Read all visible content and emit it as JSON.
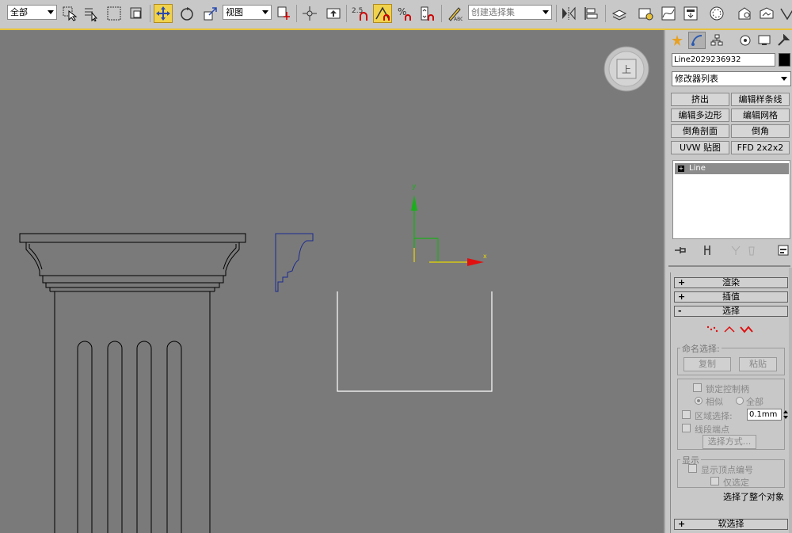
{
  "toolbar": {
    "selection_filter": "全部",
    "ref_coord_system": "视图",
    "snap_value": "2.5",
    "named_selection_placeholder": "创建选择集",
    "icons": [
      "select-object-icon",
      "select-by-name-icon",
      "rect-selection-icon",
      "window-crossing-icon",
      "select-and-move-icon",
      "select-and-rotate-icon",
      "select-and-scale-icon",
      "use-pivot-icon",
      "manipulate-icon",
      "keyboard-shortcut-icon",
      "snaps-toggle-icon",
      "angle-snap-icon",
      "percent-snap-icon",
      "spinner-snap-icon",
      "edit-named-selection-icon",
      "mirror-icon",
      "align-icon",
      "layer-manager-icon",
      "graphite-tools-icon",
      "curve-editor-icon",
      "schematic-view-icon",
      "material-editor-icon",
      "render-setup-icon",
      "rendered-frame-icon",
      "render-icon"
    ]
  },
  "viewport": {
    "viewcube_label": "上",
    "gizmo_y_label": "y",
    "gizmo_x_label": "x",
    "colors": {
      "gizmo_y": "#1cae1c",
      "gizmo_x": "#e01010",
      "gizmo_plane": "#e8d800",
      "profile_shape": "#1a2a90",
      "lines": "#000000",
      "rectangle": "#ffffff"
    }
  },
  "command_panel": {
    "tabs": [
      "create-tab-icon",
      "modify-tab-icon",
      "hierarchy-tab-icon",
      "motion-tab-icon",
      "display-tab-icon",
      "utilities-tab-icon"
    ],
    "object_name": "Line2029236932",
    "modifier_list": "修改器列表",
    "modifier_buttons": [
      "挤出",
      "编辑样条线",
      "编辑多边形",
      "编辑网格",
      "倒角剖面",
      "倒角",
      "UVW 贴图",
      "FFD 2x2x2"
    ],
    "stack_item": "Line",
    "stack_tool_icons": [
      "pin-stack-icon",
      "show-end-result-icon",
      "make-unique-icon",
      "remove-modifier-icon",
      "configure-modifier-sets-icon"
    ],
    "rollouts": {
      "render": "渲染",
      "interpolation": "插值",
      "selection": "选择",
      "soft_selection": "软选择"
    },
    "selection": {
      "named_sel_title": "命名选择:",
      "copy": "复制",
      "paste": "粘贴",
      "lock_handles": "锁定控制柄",
      "alike": "相似",
      "all": "全部",
      "area_selection": "区域选择:",
      "area_value": "0.1mm",
      "segment_end": "线段端点",
      "select_by": "选择方式...",
      "display_title": "显示",
      "show_vertex_numbers": "显示顶点编号",
      "selected_only": "仅选定",
      "status": "选择了整个对象"
    }
  }
}
